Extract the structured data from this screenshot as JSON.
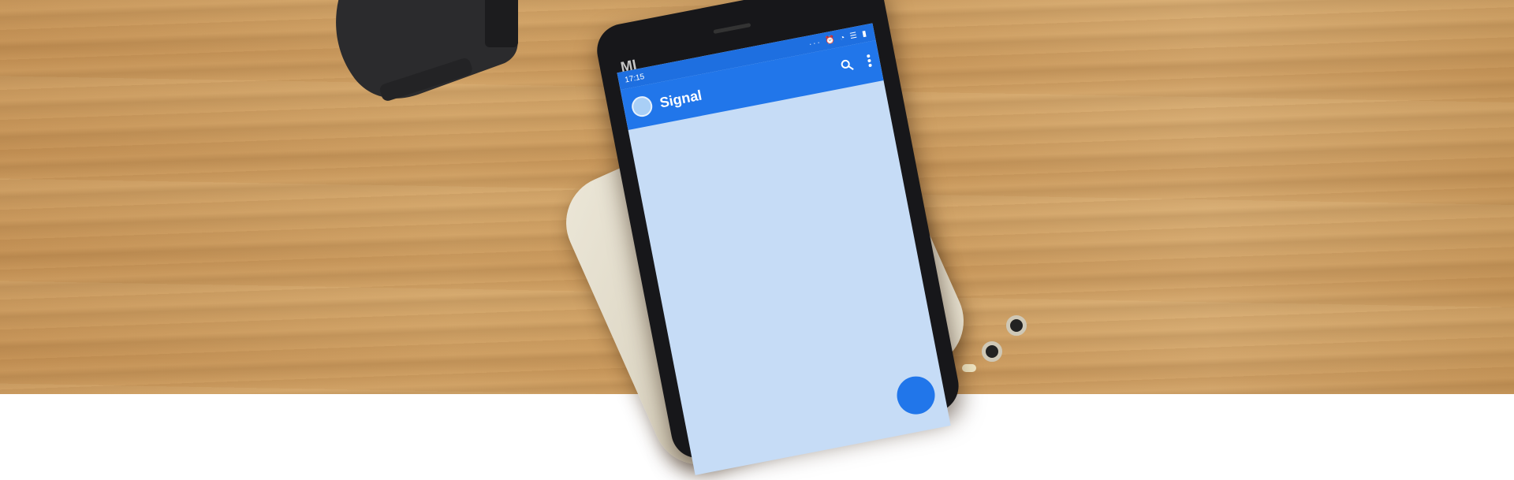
{
  "phone": {
    "brand": "MI",
    "status_time": "17:15",
    "status_icons": "··· ⏰ ◔ ☰ ▮",
    "app": {
      "title": "Signal",
      "search_icon": "search-icon",
      "menu_icon": "more-vert-icon"
    }
  },
  "colors": {
    "app_bar": "#2176ea",
    "status_bar": "#1e6fe0",
    "screen_background": "#c6dcf6"
  }
}
